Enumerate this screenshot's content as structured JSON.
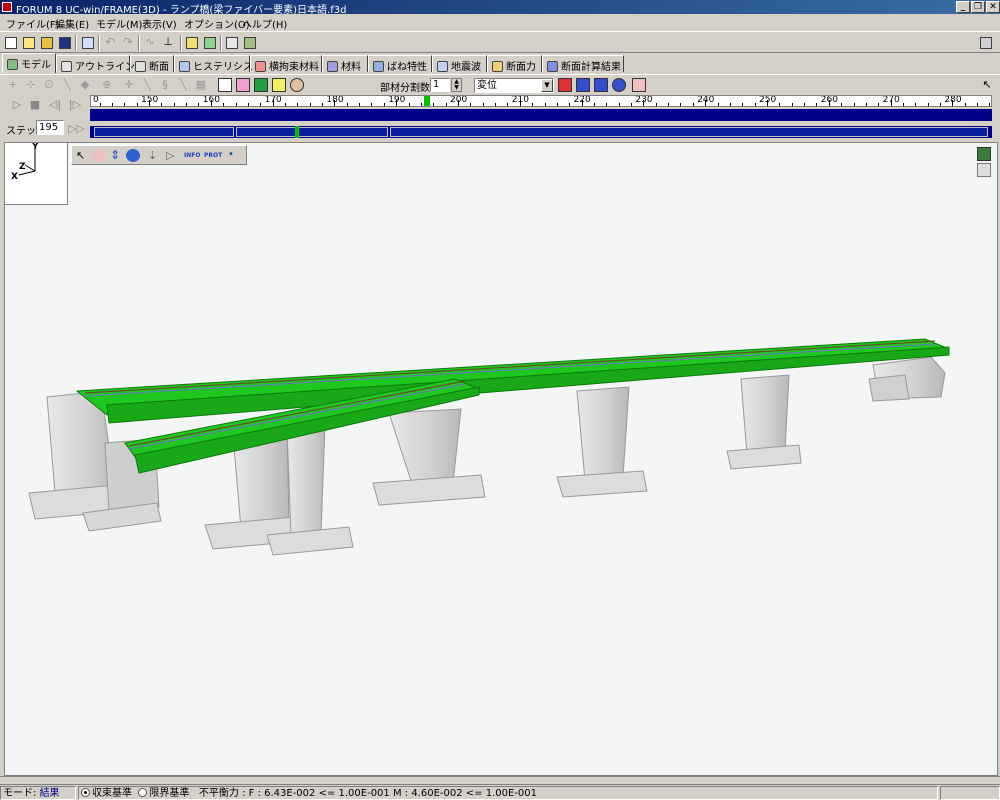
{
  "window": {
    "title": "FORUM 8  UC-win/FRAME(3D) - ランプ橋(梁ファイバー要素)日本語.f3d",
    "buttons": {
      "minimize": "_",
      "restore": "❐",
      "close": "✕"
    }
  },
  "menu": [
    {
      "label": "ファイル(F)"
    },
    {
      "label": "編集(E)"
    },
    {
      "label": "モデル(M)"
    },
    {
      "label": "表示(V)"
    },
    {
      "label": "オプション(O)"
    },
    {
      "label": "ヘルプ(H)"
    }
  ],
  "tabs": [
    {
      "label": "モデル",
      "active": true
    },
    {
      "label": "アウトライン"
    },
    {
      "label": "断面"
    },
    {
      "label": "ヒステリシス"
    },
    {
      "label": "横拘束材料"
    },
    {
      "label": "材料"
    },
    {
      "label": "ばね特性"
    },
    {
      "label": "地震波"
    },
    {
      "label": "断面力"
    },
    {
      "label": "断面計算結果"
    }
  ],
  "toolbar2": {
    "divisions_label": "部材分割数",
    "divisions_value": "1",
    "display_select": "変位"
  },
  "ruler": {
    "labels": [
      "0",
      "150",
      "160",
      "170",
      "180",
      "190",
      "200",
      "210",
      "220",
      "230",
      "240",
      "250",
      "260",
      "270",
      "280"
    ],
    "cursor_value": 195
  },
  "step": {
    "label": "ステップ",
    "value": "195"
  },
  "axes": {
    "y": "Y",
    "z": "Z",
    "x": "X"
  },
  "viewport_tools": {
    "info_label": "INFO",
    "prot_label": "PROT"
  },
  "status": {
    "mode_label": "モード:",
    "mode_value": "結果",
    "radio1": "収束基準",
    "radio2": "限界基準",
    "message": "不平衡力 : F : 6.43E-002 <= 1.00E-001  M : 4.60E-002 <= 1.00E-001"
  },
  "colors": {
    "deck": "#1ec81e",
    "pier": "#d8d8d8",
    "timeline": "#00008b"
  }
}
